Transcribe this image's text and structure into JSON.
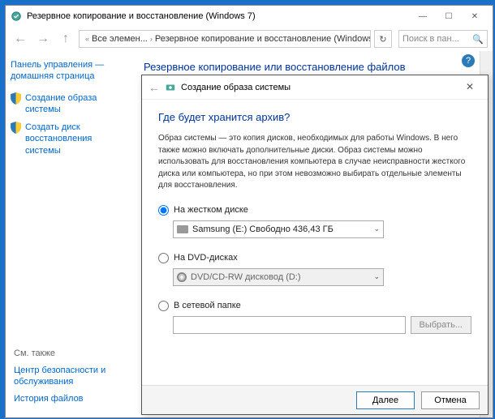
{
  "parent_window": {
    "title": "Резервное копирование и восстановление (Windows 7)",
    "breadcrumb": {
      "item1": "Все элемен...",
      "item2": "Резервное копирование и восстановление (Windows 7)"
    },
    "search_placeholder": "Поиск в пан...",
    "page_title": "Резервное копирование или восстановление файлов"
  },
  "sidebar": {
    "home": "Панель управления — домашняя страница",
    "link1": "Создание образа системы",
    "link2": "Создать диск восстановления системы",
    "see_also": "См. также",
    "bottom1": "Центр безопасности и обслуживания",
    "bottom2": "История файлов"
  },
  "wizard": {
    "title": "Создание образа системы",
    "question": "Где будет хранится архив?",
    "description": "Образ системы — это копия дисков, необходимых для работы Windows. В него также можно включать дополнительные диски. Образ системы можно использовать для восстановления компьютера в случае неисправности жесткого диска или компьютера, но при этом невозможно выбирать отдельные элементы для восстановления.",
    "opt_hdd": {
      "label": "На жестком диске",
      "value": "Samsung (E:)  Свободно 436,43 ГБ"
    },
    "opt_dvd": {
      "label": "На DVD-дисках",
      "value": "DVD/CD-RW дисковод (D:)"
    },
    "opt_net": {
      "label": "В сетевой папке",
      "browse": "Выбрать..."
    },
    "next": "Далее",
    "cancel": "Отмена"
  }
}
